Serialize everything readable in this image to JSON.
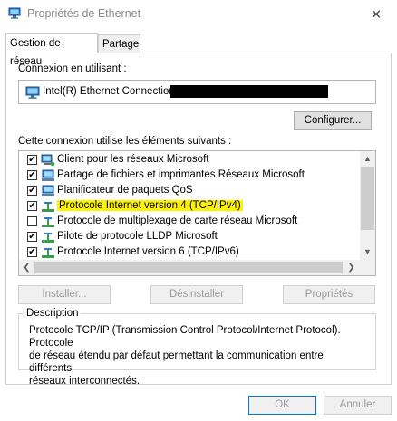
{
  "window": {
    "title": "Propriétés de Ethernet",
    "close_symbol": "✕"
  },
  "tabs": [
    {
      "label": "Gestion de réseau"
    },
    {
      "label": "Partage"
    }
  ],
  "connection": {
    "label": "Connexion en utilisant :",
    "adapter_name": "Intel(R) Ethernet Connection",
    "configure_label": "Configurer..."
  },
  "components": {
    "label": "Cette connexion utilise les éléments suivants :",
    "items": [
      {
        "label": "Client pour les réseaux Microsoft",
        "checked": true,
        "icon": "network-client-icon"
      },
      {
        "label": "Partage de fichiers et imprimantes Réseaux Microsoft",
        "checked": true,
        "icon": "network-service-icon"
      },
      {
        "label": "Planificateur de paquets QoS",
        "checked": true,
        "icon": "network-service-icon"
      },
      {
        "label": "Protocole Internet version 4 (TCP/IPv4)",
        "checked": true,
        "icon": "protocol-icon",
        "highlighted": true
      },
      {
        "label": "Protocole de multiplexage de carte réseau Microsoft",
        "checked": false,
        "icon": "protocol-icon"
      },
      {
        "label": "Pilote de protocole LLDP Microsoft",
        "checked": true,
        "icon": "protocol-icon"
      },
      {
        "label": "Protocole Internet version 6 (TCP/IPv6)",
        "checked": true,
        "icon": "protocol-icon"
      }
    ]
  },
  "buttons": {
    "install": "Installer...",
    "uninstall": "Désinstaller",
    "properties": "Propriétés",
    "ok": "OK",
    "cancel": "Annuler"
  },
  "description": {
    "title": "Description",
    "line1": "Protocole TCP/IP (Transmission Control Protocol/Internet Protocol). Protocole",
    "line2": "de réseau étendu par défaut permettant la communication entre différents",
    "line3": "réseaux interconnectés."
  },
  "colors": {
    "highlight": "#fff200",
    "accent": "#0078d7",
    "disabled_text": "#9a9a9a"
  }
}
